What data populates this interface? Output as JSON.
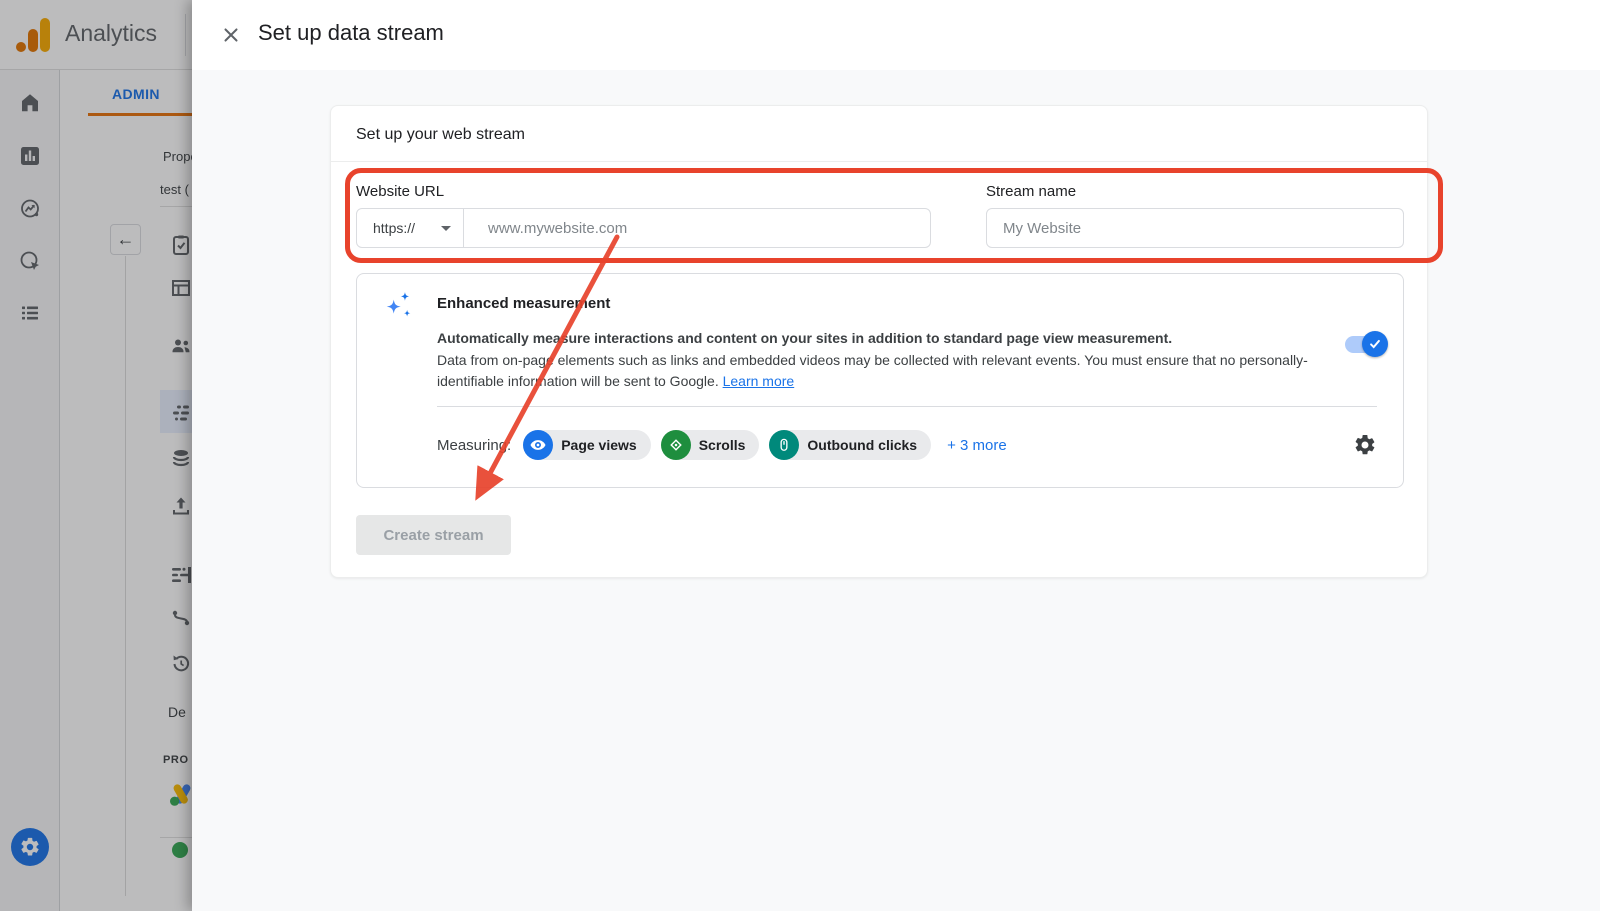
{
  "brand": {
    "name": "Analytics"
  },
  "background": {
    "admin_tab": "ADMIN",
    "property_label": "Prope",
    "property_name": "test (",
    "back_arrow": "←",
    "item_d": "De",
    "product_links_header": "PRO"
  },
  "modal": {
    "title": "Set up data stream",
    "card": {
      "heading": "Set up your web stream",
      "website_url_label": "Website URL",
      "protocol_value": "https://",
      "url_placeholder": "www.mywebsite.com",
      "stream_name_label": "Stream name",
      "stream_name_value": "My Website",
      "create_button": "Create stream"
    },
    "enhanced": {
      "title": "Enhanced measurement",
      "desc_bold": "Automatically measure interactions and content on your sites in addition to standard page view measurement.",
      "desc_rest": "Data from on-page elements such as links and embedded videos may be collected with relevant events. You must ensure that no personally-identifiable information will be sent to Google. ",
      "learn_more": "Learn more",
      "toggle_on": true,
      "measuring_label": "Measuring:",
      "chips": [
        {
          "label": "Page views",
          "icon": "eye-icon",
          "color": "#1a73e8"
        },
        {
          "label": "Scrolls",
          "icon": "scroll-icon",
          "color": "#1e8e3e"
        },
        {
          "label": "Outbound clicks",
          "icon": "mouse-icon",
          "color": "#00897b"
        }
      ],
      "more_link": "+ 3 more"
    }
  },
  "colors": {
    "accent_blue": "#1a73e8",
    "annotation_red": "#e8432c",
    "toggle_track": "#aecbfa",
    "brand_amber": "#f9ab00",
    "brand_orange": "#e37400"
  }
}
